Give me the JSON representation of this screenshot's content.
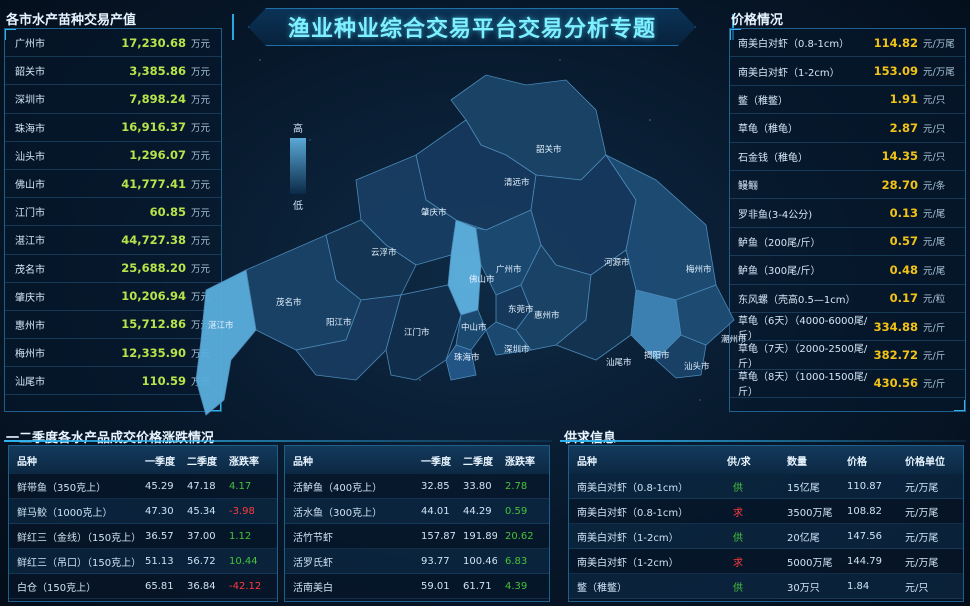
{
  "title": "渔业种业综合交易平台交易分析专题",
  "left": {
    "title": "各市水产苗种交易产值",
    "items": [
      {
        "name": "广州市",
        "value": "17,230.68",
        "unit": "万元"
      },
      {
        "name": "韶关市",
        "value": "3,385.86",
        "unit": "万元"
      },
      {
        "name": "深圳市",
        "value": "7,898.24",
        "unit": "万元"
      },
      {
        "name": "珠海市",
        "value": "16,916.37",
        "unit": "万元"
      },
      {
        "name": "汕头市",
        "value": "1,296.07",
        "unit": "万元"
      },
      {
        "name": "佛山市",
        "value": "41,777.41",
        "unit": "万元"
      },
      {
        "name": "江门市",
        "value": "60.85",
        "unit": "万元"
      },
      {
        "name": "湛江市",
        "value": "44,727.38",
        "unit": "万元"
      },
      {
        "name": "茂名市",
        "value": "25,688.20",
        "unit": "万元"
      },
      {
        "name": "肇庆市",
        "value": "10,206.94",
        "unit": "万元"
      },
      {
        "name": "惠州市",
        "value": "15,712.86",
        "unit": "万元"
      },
      {
        "name": "梅州市",
        "value": "12,335.90",
        "unit": "万元"
      },
      {
        "name": "汕尾市",
        "value": "110.59",
        "unit": "万元"
      }
    ]
  },
  "right": {
    "title": "价格情况",
    "items": [
      {
        "name": "南美白对虾（0.8-1cm）",
        "value": "114.82",
        "unit": "元/万尾"
      },
      {
        "name": "南美白对虾（1-2cm）",
        "value": "153.09",
        "unit": "元/万尾"
      },
      {
        "name": "鳖（稚鳖）",
        "value": "1.91",
        "unit": "元/只"
      },
      {
        "name": "草龟（稚龟）",
        "value": "2.87",
        "unit": "元/只"
      },
      {
        "name": "石金钱（稚龟）",
        "value": "14.35",
        "unit": "元/只"
      },
      {
        "name": "鳗鲡",
        "value": "28.70",
        "unit": "元/条"
      },
      {
        "name": "罗非鱼(3-4公分)",
        "value": "0.13",
        "unit": "元/尾"
      },
      {
        "name": "鲈鱼（200尾/斤）",
        "value": "0.57",
        "unit": "元/尾"
      },
      {
        "name": "鲈鱼（300尾/斤）",
        "value": "0.48",
        "unit": "元/尾"
      },
      {
        "name": "东风螺（壳高0.5—1cm）",
        "value": "0.17",
        "unit": "元/粒"
      },
      {
        "name": "草龟（6天）（4000-6000尾/斤）",
        "value": "334.88",
        "unit": "元/斤"
      },
      {
        "name": "草龟（7天）（2000-2500尾/斤）",
        "value": "382.72",
        "unit": "元/斤"
      },
      {
        "name": "草龟（8天）（1000-1500尾/斤）",
        "value": "430.56",
        "unit": "元/斤"
      }
    ]
  },
  "map": {
    "legend_high": "高",
    "legend_low": "低",
    "cities": [
      "韶关市",
      "清远市",
      "肇庆市",
      "云浮市",
      "佛山市",
      "广州市",
      "河源市",
      "梅州市",
      "茂名市",
      "阳江市",
      "江门市",
      "中山市",
      "东莞市",
      "惠州市",
      "深圳市",
      "珠海市",
      "湛江市",
      "汕尾市",
      "揭阳市",
      "汕头市",
      "潮州市"
    ]
  },
  "change": {
    "title": "一二季度各水产品成交价格涨跌情况",
    "headers": [
      "品种",
      "一季度",
      "二季度",
      "涨跌率"
    ],
    "left_rows": [
      {
        "name": "鲜带鱼（350克上）",
        "q1": "45.29",
        "q2": "47.18",
        "rate": "4.17",
        "dir": "up"
      },
      {
        "name": "鲜马鲛（1000克上）",
        "q1": "47.30",
        "q2": "45.34",
        "rate": "-3.98",
        "dir": "down"
      },
      {
        "name": "鲜红三（金线）（150克上）",
        "q1": "36.57",
        "q2": "37.00",
        "rate": "1.12",
        "dir": "up"
      },
      {
        "name": "鲜红三（吊口）（150克上）",
        "q1": "51.13",
        "q2": "56.72",
        "rate": "10.44",
        "dir": "up"
      },
      {
        "name": "白仓（150克上）",
        "q1": "65.81",
        "q2": "36.84",
        "rate": "-42.12",
        "dir": "down"
      }
    ],
    "right_rows": [
      {
        "name": "活鲈鱼（400克上）",
        "q1": "32.85",
        "q2": "33.80",
        "rate": "2.78",
        "dir": "up"
      },
      {
        "name": "活水鱼（300克上）",
        "q1": "44.01",
        "q2": "44.29",
        "rate": "0.59",
        "dir": "up"
      },
      {
        "name": "活竹节虾",
        "q1": "157.87",
        "q2": "191.89",
        "rate": "20.62",
        "dir": "up"
      },
      {
        "name": "活罗氏虾",
        "q1": "93.77",
        "q2": "100.46",
        "rate": "6.83",
        "dir": "up"
      },
      {
        "name": "活南美白",
        "q1": "59.01",
        "q2": "61.71",
        "rate": "4.39",
        "dir": "up"
      }
    ]
  },
  "supply": {
    "title": "供求信息",
    "headers": [
      "品种",
      "供/求",
      "数量",
      "价格",
      "价格单位"
    ],
    "rows": [
      {
        "name": "南美白对虾（0.8-1cm）",
        "type": "供",
        "kind": "supply",
        "qty": "15亿尾",
        "price": "110.87",
        "unit": "元/万尾"
      },
      {
        "name": "南美白对虾（0.8-1cm）",
        "type": "求",
        "kind": "demand",
        "qty": "3500万尾",
        "price": "108.82",
        "unit": "元/万尾"
      },
      {
        "name": "南美白对虾（1-2cm）",
        "type": "供",
        "kind": "supply",
        "qty": "20亿尾",
        "price": "147.56",
        "unit": "元/万尾"
      },
      {
        "name": "南美白对虾（1-2cm）",
        "type": "求",
        "kind": "demand",
        "qty": "5000万尾",
        "price": "144.79",
        "unit": "元/万尾"
      },
      {
        "name": "鳖（稚鳖）",
        "type": "供",
        "kind": "supply",
        "qty": "30万只",
        "price": "1.84",
        "unit": "元/只"
      }
    ]
  }
}
